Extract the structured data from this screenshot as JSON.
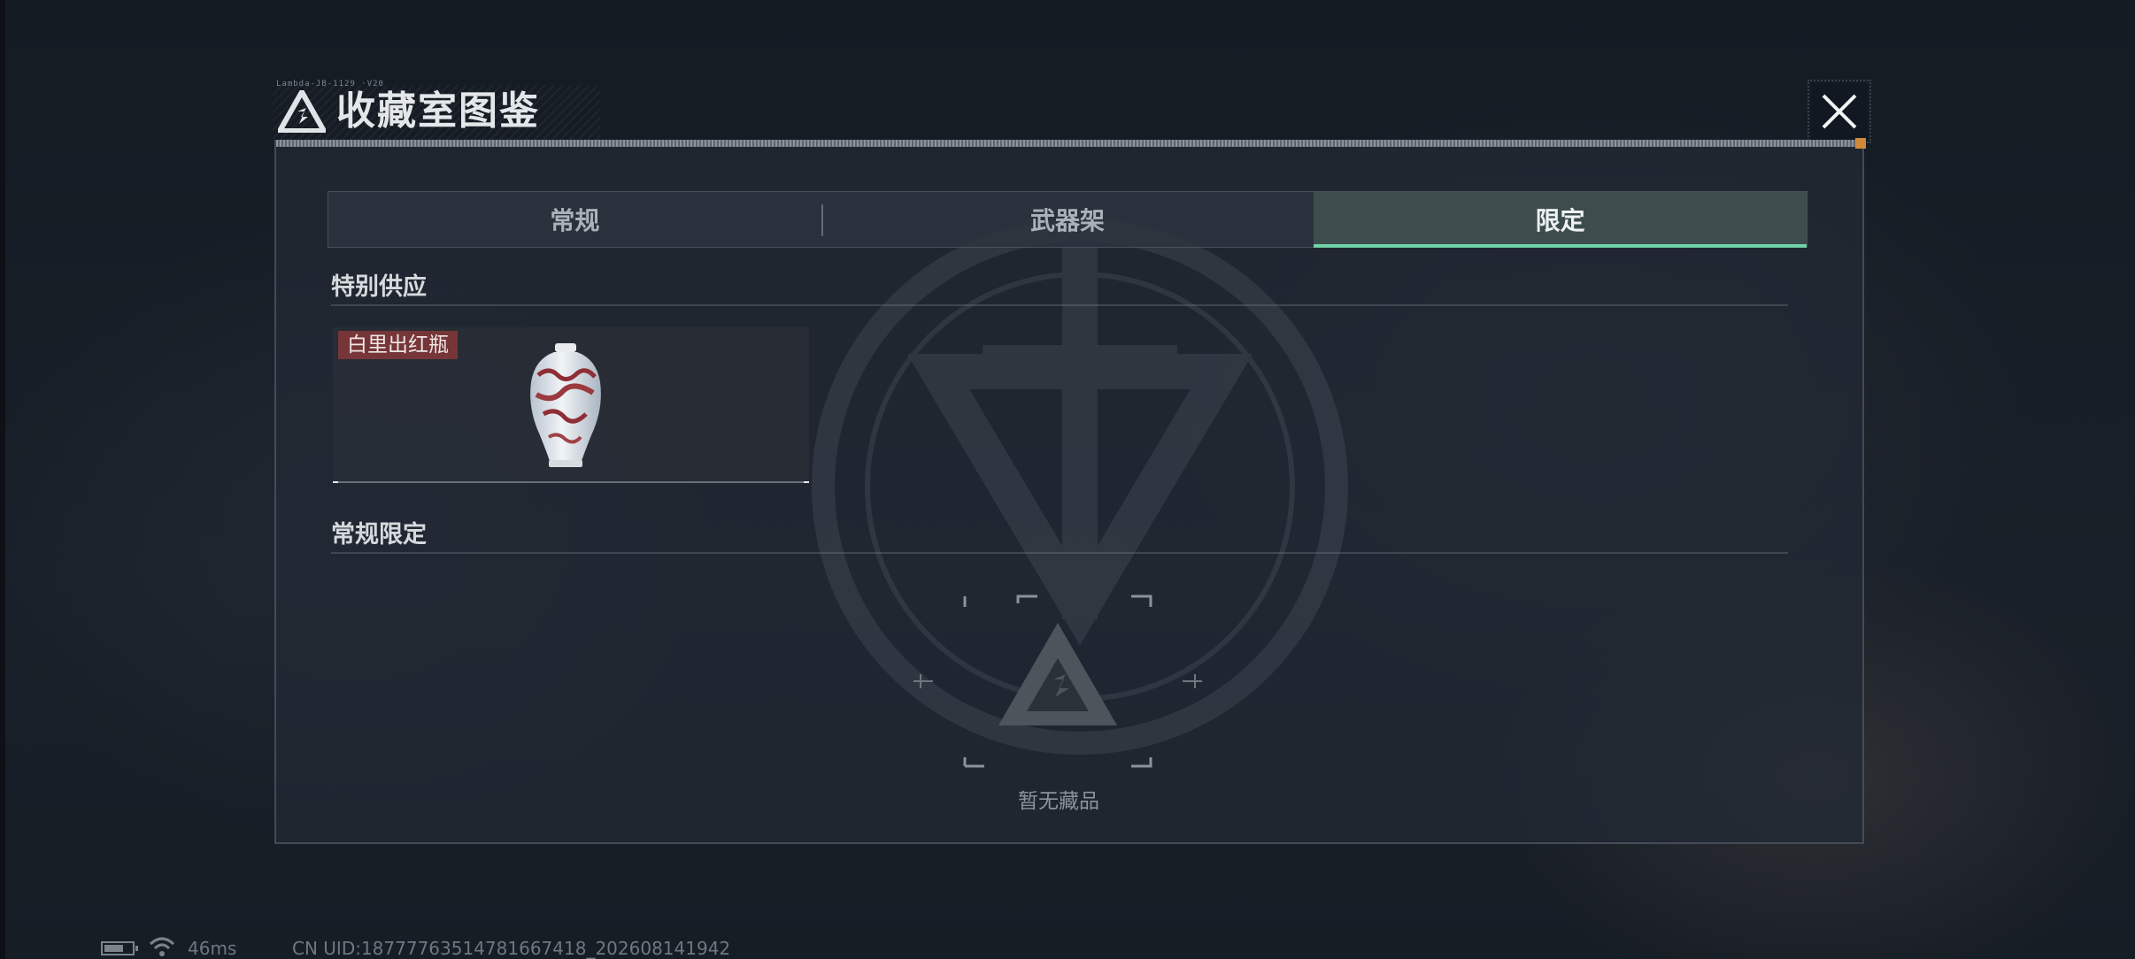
{
  "window": {
    "title": "收藏室图鉴",
    "title_small_text": "Lambda-JB-1129 ·V20"
  },
  "tabs": [
    {
      "label": "常规",
      "active": false
    },
    {
      "label": "武器架",
      "active": false
    },
    {
      "label": "限定",
      "active": true
    }
  ],
  "sections": {
    "special_supply": {
      "title": "特别供应",
      "items": [
        {
          "name": "白里出红瓶",
          "icon": "vase-icon"
        }
      ]
    },
    "regular_limited": {
      "title": "常规限定",
      "empty_text": "暂无藏品"
    }
  },
  "status_bar": {
    "battery_level": 0.7,
    "ping": "46ms",
    "uid": "CN UID:1877776351478166741​8_202608141942"
  },
  "colors": {
    "accent_tab": "#6fd3a7",
    "item_tag_bg": "#963a3a",
    "panel_bg": "#222a34",
    "corner_orange": "#d08a3a"
  }
}
